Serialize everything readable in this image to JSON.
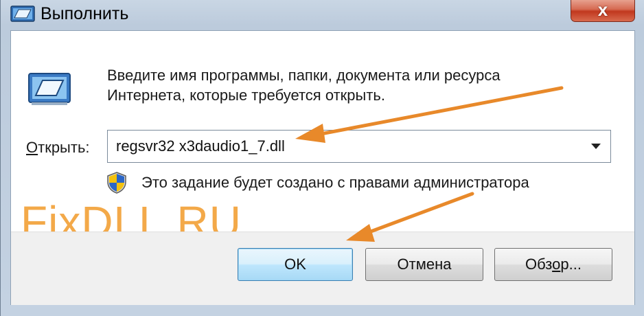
{
  "window": {
    "title": "Выполнить",
    "close_label": "x"
  },
  "dialog": {
    "description_line1": "Введите имя программы, папки, документа или ресурса",
    "description_line2": "Интернета, которые требуется открыть.",
    "open_label_accel": "О",
    "open_label_rest": "ткрыть:",
    "command_value": "regsvr32 x3daudio1_7.dll",
    "admin_note": "Это задание будет создано с правами администратора"
  },
  "watermark": "FixDLL.RU",
  "buttons": {
    "ok": "OK",
    "cancel": "Отмена",
    "browse_pre": "Обз",
    "browse_accel": "о",
    "browse_post": "р..."
  },
  "colors": {
    "annotation_arrow": "#e8892a",
    "watermark": "#f2a23a",
    "ok_border": "#3c7fb1"
  },
  "icons": {
    "title": "run-dialog-icon",
    "app": "run-program-icon",
    "shield": "uac-shield-icon",
    "dropdown": "chevron-down-icon"
  }
}
